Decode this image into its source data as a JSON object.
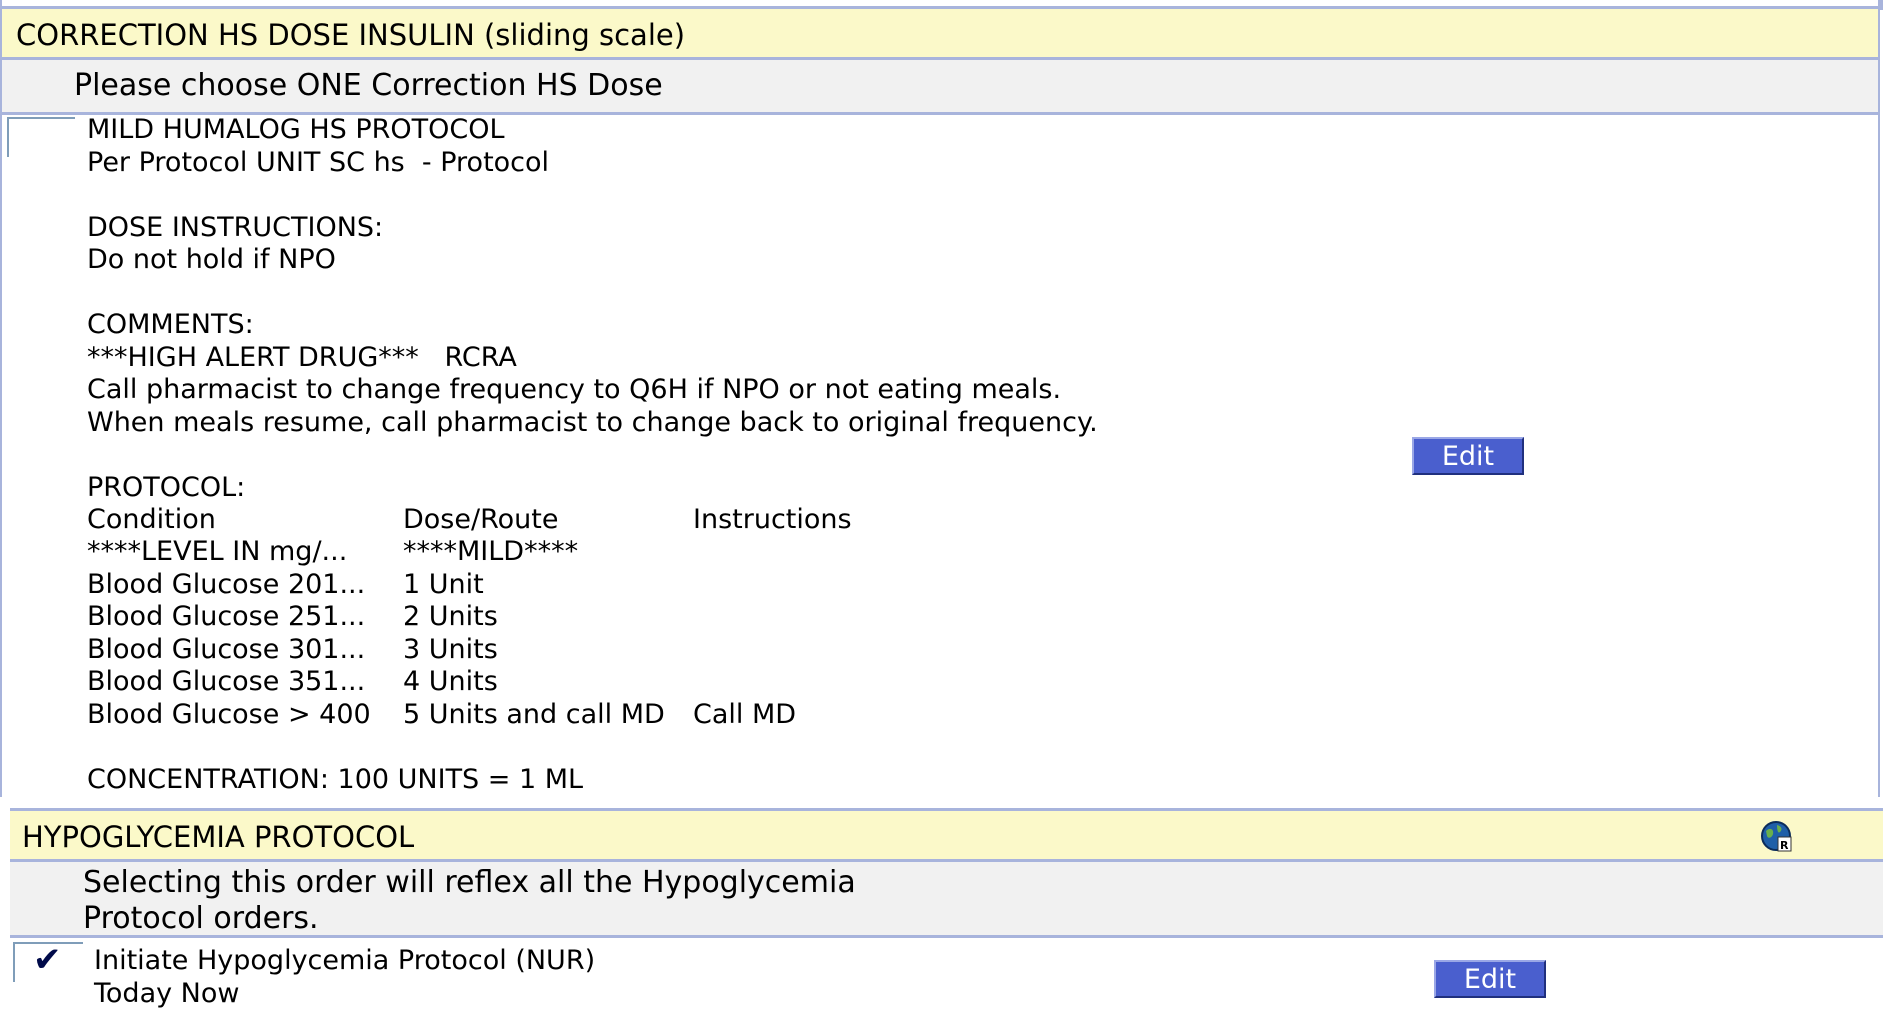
{
  "section1": {
    "header": "CORRECTION HS DOSE INSULIN (sliding scale)",
    "subheader": "Please choose ONE Correction HS Dose",
    "order_lines": [
      "MILD HUMALOG HS PROTOCOL",
      "Per Protocol UNIT SC hs  - Protocol",
      "",
      "DOSE INSTRUCTIONS:",
      "Do not hold if NPO",
      "",
      "COMMENTS:",
      "***HIGH ALERT DRUG***   RCRA",
      "Call pharmacist to change frequency to Q6H if NPO or not eating meals.",
      "When meals resume, call pharmacist to change back to original frequency.",
      "",
      "PROTOCOL:"
    ],
    "protocol_table": {
      "headers": [
        "Condition",
        "Dose/Route",
        "Instructions"
      ],
      "rows": [
        [
          "****LEVEL IN mg/...",
          "****MILD****",
          ""
        ],
        [
          "Blood Glucose 201...",
          "1 Unit",
          ""
        ],
        [
          "Blood Glucose 251...",
          "2 Units",
          ""
        ],
        [
          "Blood Glucose 301...",
          "3 Units",
          ""
        ],
        [
          "Blood Glucose 351...",
          "4 Units",
          ""
        ],
        [
          "Blood Glucose > 400",
          "5 Units and call MD",
          "Call MD"
        ]
      ]
    },
    "concentration": "CONCENTRATION: 100 UNITS = 1 ML",
    "checked": false,
    "edit_label": "Edit"
  },
  "section2": {
    "header": "HYPOGLYCEMIA PROTOCOL",
    "subheader_line1": "Selecting this order will reflex all the Hypoglycemia",
    "subheader_line2": "Protocol orders.",
    "order_line1": "Initiate Hypoglycemia Protocol (NUR)",
    "order_line2": "Today Now",
    "checked": true,
    "checkmark_glyph": "✔",
    "edit_label": "Edit",
    "icon": "globe-rx-icon"
  },
  "colors": {
    "header_bg": "#fbf9c9",
    "border": "#a8b4dc",
    "subheader_bg": "#f1f1f1",
    "button_bg": "#4a5fce",
    "checkmark": "#000a4a"
  }
}
